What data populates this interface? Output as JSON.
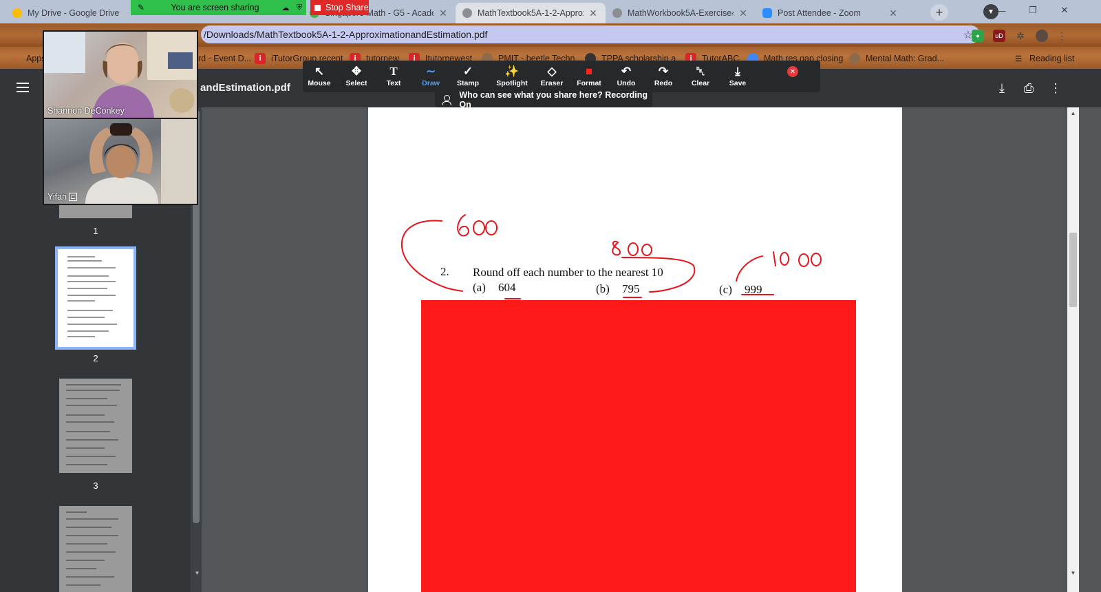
{
  "tabs": [
    {
      "label": "My Drive - Google Drive",
      "color": "#fbbc04",
      "active": false
    },
    {
      "label": "Singapore Math - G5 - Academ",
      "color": "#4caf50",
      "active": false
    },
    {
      "label": "MathTextbook5A-1-2-Approxi",
      "color": "#5f6368",
      "active": true
    },
    {
      "label": "MathWorkbook5A-Exercise4_",
      "color": "#5f6368",
      "active": false
    },
    {
      "label": "Post Attendee - Zoom",
      "color": "#2d8cff",
      "active": false
    }
  ],
  "share_banner": {
    "text": "You are screen sharing",
    "stop_label": "Stop Share"
  },
  "address_bar": {
    "url": "/Downloads/MathTextbook5A-1-2-ApproximationandEstimation.pdf"
  },
  "bookmarks": [
    {
      "label": "Apps",
      "icon": "apps-grid-icon",
      "color": "#34a853"
    },
    {
      "label": "rd - Event D...",
      "icon": "bookmark-icon",
      "color": "#777777"
    },
    {
      "label": "iTutorGroup recent",
      "icon": "itutor-icon",
      "color": "#d7262a"
    },
    {
      "label": "tutornew",
      "icon": "itutor-icon",
      "color": "#d7262a"
    },
    {
      "label": "Itutornewest",
      "icon": "itutor-icon",
      "color": "#d7262a"
    },
    {
      "label": "PMIT - beetle Techn...",
      "icon": "globe-icon",
      "color": "#8c6a4a"
    },
    {
      "label": "TPPA scholarship a...",
      "icon": "cat-icon",
      "color": "#333333"
    },
    {
      "label": "TutorABC",
      "icon": "itutor-icon",
      "color": "#d7262a"
    },
    {
      "label": "Math res gap closing",
      "icon": "globe-icon",
      "color": "#4285f4"
    },
    {
      "label": "Mental Math: Grad...",
      "icon": "globe-icon",
      "color": "#8c6a4a"
    },
    {
      "label": "Reading list",
      "icon": "reading-list-icon",
      "color": "#555555"
    }
  ],
  "pdf_viewer": {
    "title": "andEstimation.pdf",
    "pages": [
      "1",
      "2",
      "3"
    ]
  },
  "annotate_tools": [
    {
      "label": "Mouse",
      "icon": "cursor-icon",
      "glyph": "↖"
    },
    {
      "label": "Select",
      "icon": "move-icon",
      "glyph": "✥"
    },
    {
      "label": "Text",
      "icon": "text-icon",
      "glyph": "T"
    },
    {
      "label": "Draw",
      "icon": "draw-icon",
      "glyph": "∼"
    },
    {
      "label": "Stamp",
      "icon": "stamp-icon",
      "glyph": "✓"
    },
    {
      "label": "Spotlight",
      "icon": "spotlight-icon",
      "glyph": "✨"
    },
    {
      "label": "Eraser",
      "icon": "eraser-icon",
      "glyph": "◇"
    },
    {
      "label": "Format",
      "icon": "format-icon",
      "glyph": "■"
    },
    {
      "label": "Undo",
      "icon": "undo-icon",
      "glyph": "↶"
    },
    {
      "label": "Redo",
      "icon": "redo-icon",
      "glyph": "↷"
    },
    {
      "label": "Clear",
      "icon": "trash-icon",
      "glyph": "␡"
    },
    {
      "label": "Save",
      "icon": "save-icon",
      "glyph": "⤓"
    }
  ],
  "recording_notice": "Who can see what you share here? Recording On",
  "participants": [
    {
      "name": "Shannon DeConkey"
    },
    {
      "name": "Yifan"
    }
  ],
  "document": {
    "question_number": "2.",
    "question_text": "Round off each number to the nearest 10",
    "items": [
      {
        "label": "(a)",
        "value": "604"
      },
      {
        "label": "(b)",
        "value": "795"
      },
      {
        "label": "(c)",
        "value": "999"
      }
    ]
  },
  "colors": {
    "ink": "#e8141c",
    "redact": "#ff1a1a",
    "share_green": "#2fc04b",
    "stop_red": "#e02828",
    "zoom_blue": "#4aa3ff"
  }
}
